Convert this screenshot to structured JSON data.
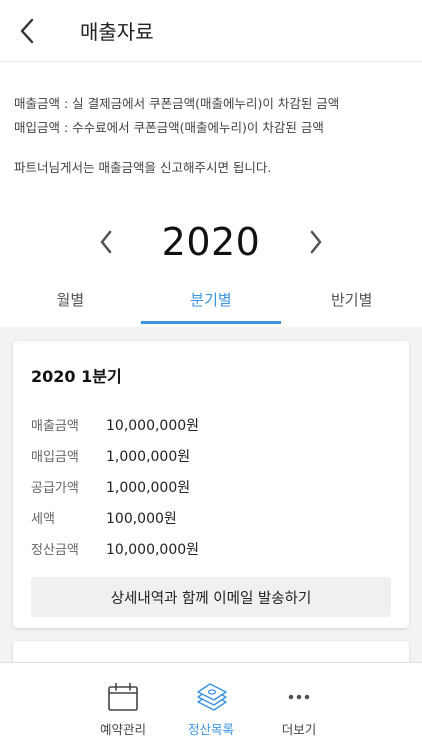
{
  "header": {
    "title": "매출자료",
    "back_icon": "chevron-left-icon"
  },
  "notes": {
    "line1": "매출금액 : 실 결제금에서 쿠폰금액(매출에누리)이 차감된 금액",
    "line2": "매입금액 : 수수료에서 쿠폰금액(매출에누리)이 차감된 금액",
    "line3": "파트너님게서는 매출금액을 신고해주시면 됩니다."
  },
  "year_selector": {
    "year": "2020"
  },
  "tabs": [
    {
      "label": "월별",
      "active": false
    },
    {
      "label": "분기별",
      "active": true
    },
    {
      "label": "반기별",
      "active": false
    }
  ],
  "card": {
    "title": "2020 1분기",
    "rows": [
      {
        "label": "매출금액",
        "value": "10,000,000원"
      },
      {
        "label": "매입금액",
        "value": "1,000,000원"
      },
      {
        "label": "공급가액",
        "value": "1,000,000원"
      },
      {
        "label": "세액",
        "value": "100,000원"
      },
      {
        "label": "정산금액",
        "value": "10,000,000원"
      }
    ],
    "email_button": "상세내역과 함께 이메일 발송하기"
  },
  "bottom_nav": [
    {
      "label": "예약관리",
      "icon": "calendar-icon",
      "active": false
    },
    {
      "label": "정산목록",
      "icon": "money-stack-icon",
      "active": true
    },
    {
      "label": "더보기",
      "icon": "more-dots-icon",
      "active": false
    }
  ],
  "colors": {
    "accent": "#3d95e0",
    "content_bg": "#f3f3f3"
  }
}
